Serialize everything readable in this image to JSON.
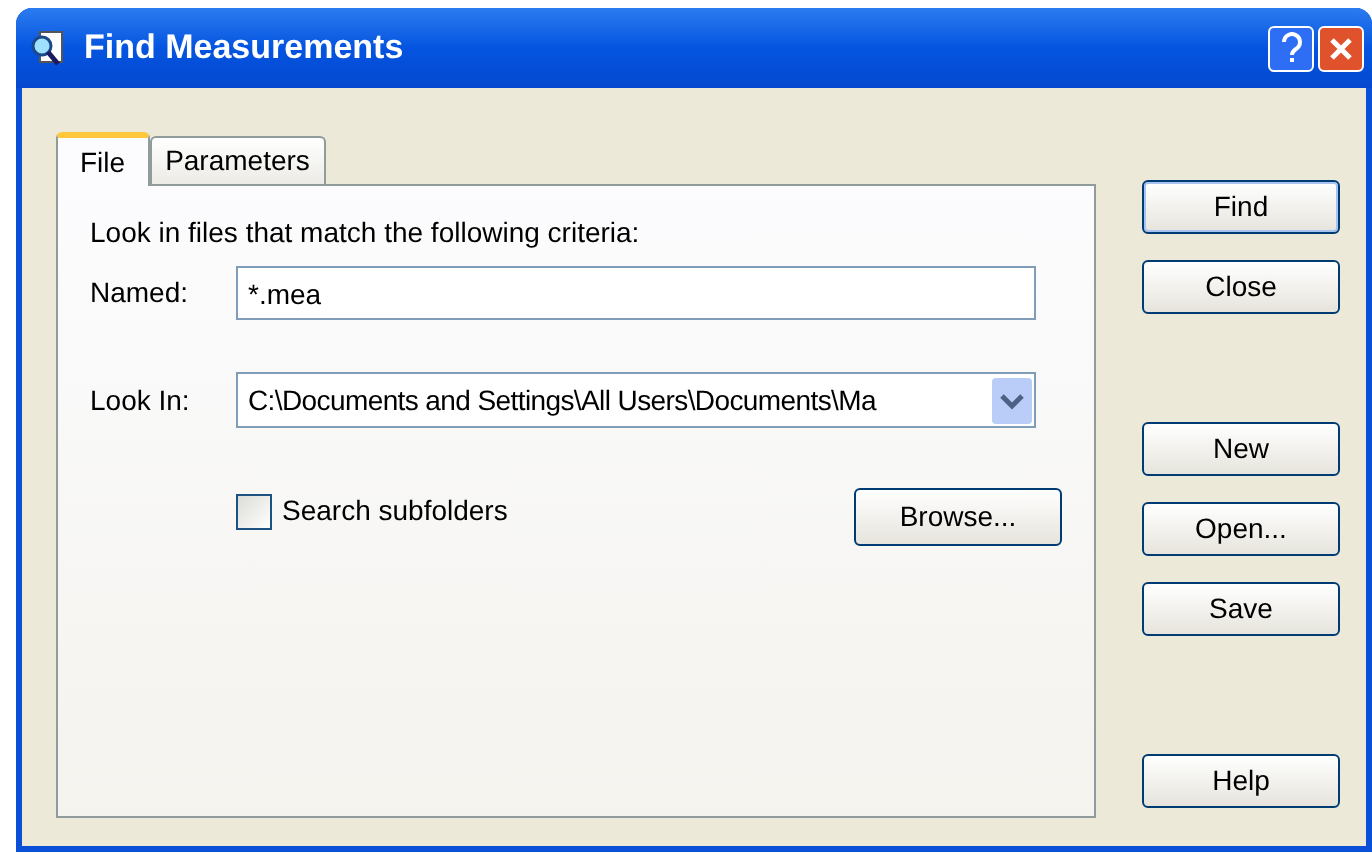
{
  "window": {
    "title": "Find Measurements"
  },
  "tabs": [
    {
      "label": "File",
      "selected": true
    },
    {
      "label": "Parameters",
      "selected": false
    }
  ],
  "criteria_text": "Look in files that match the following criteria:",
  "named": {
    "label": "Named:",
    "value": "*.mea"
  },
  "look_in": {
    "label": "Look In:",
    "value": "C:\\Documents and Settings\\All Users\\Documents\\Ma"
  },
  "search_subfolders": {
    "label": "Search subfolders",
    "checked": false
  },
  "browse_button": "Browse...",
  "buttons": [
    {
      "label": "Find",
      "kind": "primary"
    },
    {
      "label": "Close",
      "kind": "normal"
    },
    {
      "label": "New",
      "kind": "gap"
    },
    {
      "label": "Open...",
      "kind": "normal"
    },
    {
      "label": "Save",
      "kind": "normal"
    },
    {
      "label": "Help",
      "kind": "bottom"
    }
  ]
}
